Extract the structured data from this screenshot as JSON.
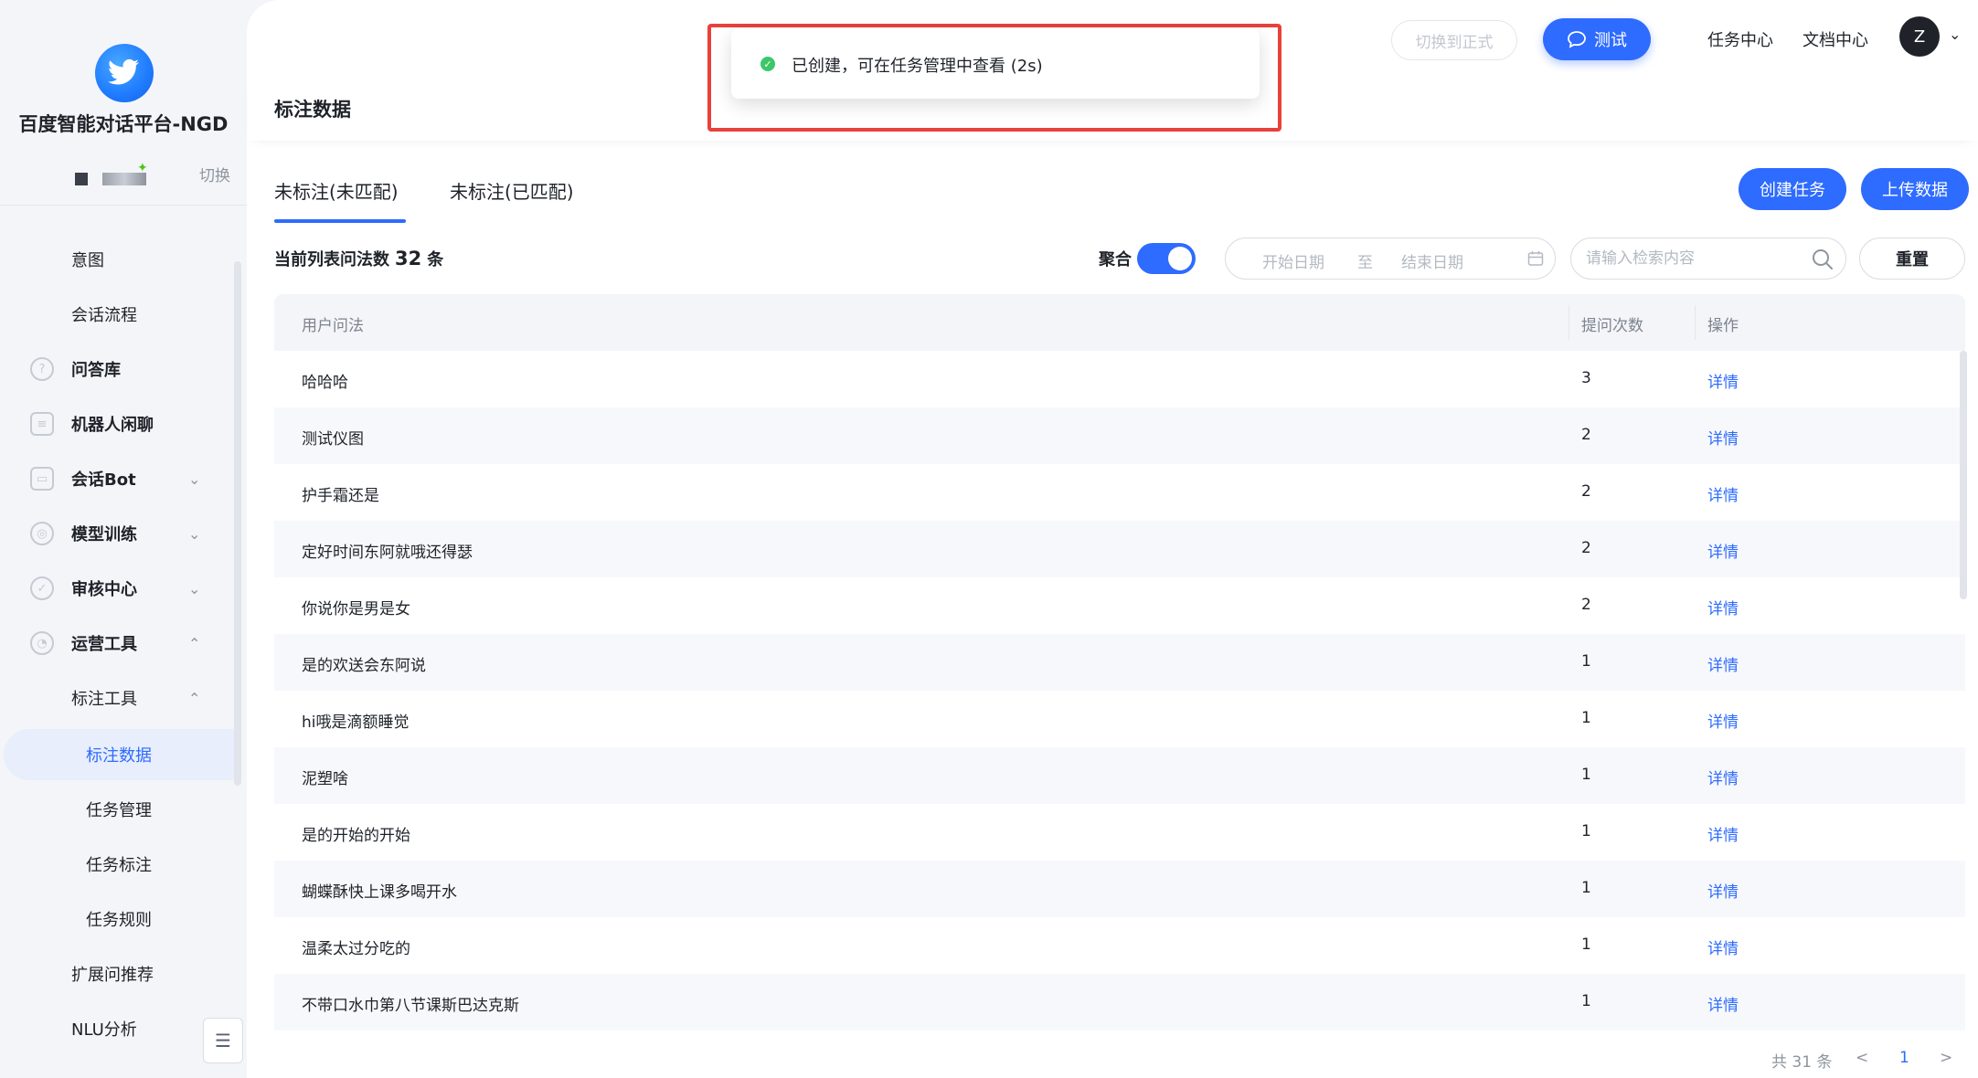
{
  "sidebar": {
    "brand": "百度智能对话平台-NGD",
    "switch_label": "切换",
    "items": [
      {
        "label": "意图",
        "icon": "none"
      },
      {
        "label": "会话流程",
        "icon": "none"
      },
      {
        "label": "问答库",
        "icon": "question-icon"
      },
      {
        "label": "机器人闲聊",
        "icon": "chat-icon"
      },
      {
        "label": "会话Bot",
        "icon": "bot-icon"
      },
      {
        "label": "模型训练",
        "icon": "train-icon"
      },
      {
        "label": "审核中心",
        "icon": "shield-icon"
      },
      {
        "label": "运营工具",
        "icon": "tool-icon"
      },
      {
        "label": "标注工具",
        "icon": "none"
      },
      {
        "label": "标注数据",
        "icon": "none"
      },
      {
        "label": "任务管理",
        "icon": "none"
      },
      {
        "label": "任务标注",
        "icon": "none"
      },
      {
        "label": "任务规则",
        "icon": "none"
      },
      {
        "label": "扩展问推荐",
        "icon": "none"
      },
      {
        "label": "NLU分析",
        "icon": "none"
      }
    ]
  },
  "topbar": {
    "switch_btn": "切换到正式",
    "test_btn": "测试",
    "task_center": "任务中心",
    "doc_center": "文档中心",
    "avatar_letter": "Z"
  },
  "page": {
    "title": "标注数据",
    "tabs": [
      "未标注(未匹配)",
      "未标注(已匹配)"
    ],
    "create_task": "创建任务",
    "upload_data": "上传数据",
    "count_prefix": "当前列表问法数",
    "count_value": "32",
    "count_suffix": "条",
    "aggregate_label": "聚合",
    "date_start_placeholder": "开始日期",
    "date_to": "至",
    "date_end_placeholder": "结束日期",
    "search_placeholder": "请输入检索内容",
    "reset_btn": "重置"
  },
  "table": {
    "headers": [
      "用户问法",
      "提问次数",
      "操作"
    ],
    "rows": [
      {
        "question": "哈哈哈",
        "count": "3",
        "action": "详情"
      },
      {
        "question": "测试仪图",
        "count": "2",
        "action": "详情"
      },
      {
        "question": "护手霜还是",
        "count": "2",
        "action": "详情"
      },
      {
        "question": "定好时间东阿就哦还得瑟",
        "count": "2",
        "action": "详情"
      },
      {
        "question": "你说你是男是女",
        "count": "2",
        "action": "详情"
      },
      {
        "question": "是的欢送会东阿说",
        "count": "1",
        "action": "详情"
      },
      {
        "question": "hi哦是滴额睡觉",
        "count": "1",
        "action": "详情"
      },
      {
        "question": "泥塑啥",
        "count": "1",
        "action": "详情"
      },
      {
        "question": "是的开始的开始",
        "count": "1",
        "action": "详情"
      },
      {
        "question": "蝴蝶酥快上课多喝开水",
        "count": "1",
        "action": "详情"
      },
      {
        "question": "温柔太过分吃的",
        "count": "1",
        "action": "详情"
      },
      {
        "question": "不带口水巾第八节课斯巴达克斯",
        "count": "1",
        "action": "详情"
      }
    ]
  },
  "pagination": {
    "total": "共 31 条",
    "prev": "<",
    "current": "1",
    "next": ">"
  },
  "toast": {
    "message": "已创建，可在任务管理中查看 (2s)"
  },
  "colors": {
    "accent": "#2e6bff",
    "success": "#3cc76b",
    "highlight_border": "#e8413b"
  }
}
